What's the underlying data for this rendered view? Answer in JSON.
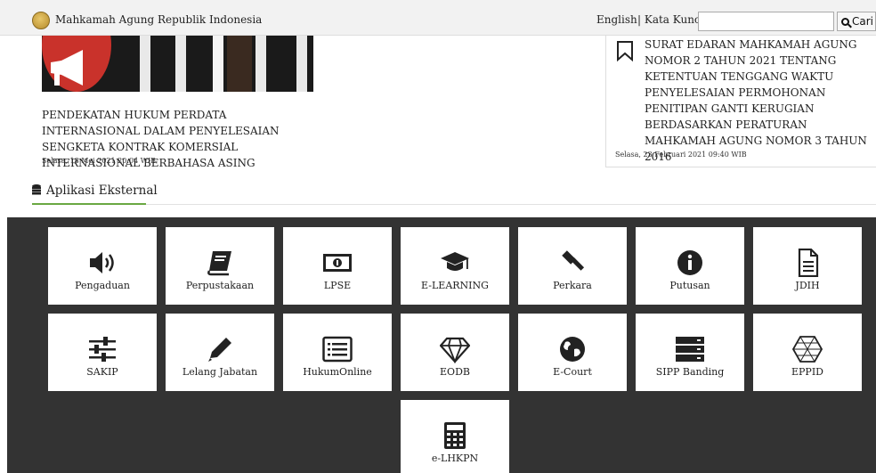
{
  "header": {
    "brand": "Mahkamah Agung Republik Indonesia",
    "lang": "English",
    "keyword_label": "| Kata Kunci",
    "search_placeholder": "",
    "search_button": "Cari"
  },
  "news": [
    {
      "title": "PENDEKATAN HUKUM PERDATA INTERNASIONAL DALAM PENYELESAIAN SENGKETA KONTRAK KOMERSIAL INTERNASIONAL BERBAHASA ASING",
      "date": "Selasa, 18 Mei 2021 20:04 WIB"
    },
    {
      "title": "SURAT EDARAN MAHKAMAH AGUNG NOMOR 2 TAHUN 2021 TENTANG KETENTUAN TENGGANG WAKTU PENYELESAIAN PERMOHONAN PENITIPAN GANTI KERUGIAN BERDASARKAN PERATURAN MAHKAMAH AGUNG NOMOR 3 TAHUN 2016",
      "date": "Selasa, 23 Februari 2021 09:40 WIB"
    }
  ],
  "section": {
    "title": "Aplikasi Eksternal"
  },
  "apps": [
    {
      "label": "Pengaduan",
      "icon": "speaker-icon"
    },
    {
      "label": "Perpustakaan",
      "icon": "book-icon"
    },
    {
      "label": "LPSE",
      "icon": "money-icon"
    },
    {
      "label": "E-LEARNING",
      "icon": "graduation-cap-icon"
    },
    {
      "label": "Perkara",
      "icon": "gavel-icon"
    },
    {
      "label": "Putusan",
      "icon": "info-icon"
    },
    {
      "label": "JDIH",
      "icon": "document-icon"
    },
    {
      "label": "SAKIP",
      "icon": "sliders-icon"
    },
    {
      "label": "Lelang Jabatan",
      "icon": "pencil-icon"
    },
    {
      "label": "HukumOnline",
      "icon": "list-icon"
    },
    {
      "label": "EODB",
      "icon": "diamond-icon"
    },
    {
      "label": "E-Court",
      "icon": "globe-icon"
    },
    {
      "label": "SIPP Banding",
      "icon": "server-icon"
    },
    {
      "label": "EPPID",
      "icon": "network-icon"
    },
    {
      "label": "e-LHKPN",
      "icon": "calculator-icon"
    }
  ]
}
